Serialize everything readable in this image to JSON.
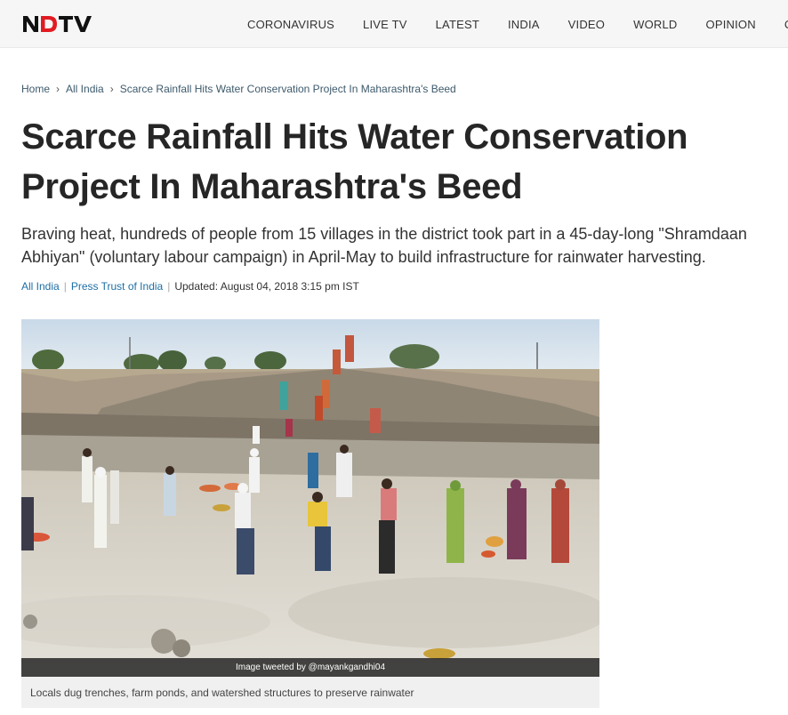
{
  "header": {
    "logo_text": "NDTV",
    "nav": [
      "CORONAVIRUS",
      "LIVE TV",
      "LATEST",
      "INDIA",
      "VIDEO",
      "WORLD",
      "OPINION",
      "CITIES"
    ]
  },
  "breadcrumb": {
    "home": "Home",
    "section": "All India",
    "current": "Scarce Rainfall Hits Water Conservation Project In Maharashtra's Beed",
    "separator": "›"
  },
  "article": {
    "headline": "Scarce Rainfall Hits Water Conservation Project In Maharashtra's Beed",
    "summary": "Braving heat, hundreds of people from 15 villages in the district took part in a 45-day-long \"Shramdaan Abhiyan\" (voluntary labour campaign) in April-May to build infrastructure for rainwater harvesting.",
    "meta": {
      "category": "All India",
      "source": "Press Trust of India",
      "updated": "Updated: August 04, 2018 3:15 pm IST",
      "separator": "|"
    },
    "image": {
      "credit": "Image tweeted by @mayankgandhi04",
      "caption": "Locals dug trenches, farm ponds, and watershed structures to preserve rainwater"
    }
  },
  "colors": {
    "topbar_bg": "#f6f6f6",
    "link": "#1d6fa5",
    "breadcrumb": "#3d5a6c",
    "headline": "#262626",
    "caption_bg": "#f0f0f0"
  }
}
